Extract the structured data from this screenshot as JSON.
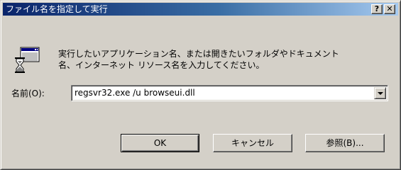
{
  "window": {
    "title": "ファイル名を指定して実行",
    "help_glyph": "?",
    "close_glyph": "✕"
  },
  "dialog": {
    "icon": "run-program-icon",
    "description_line1": "実行したいアプリケーション名、または開きたいフォルダやドキュメント",
    "description_line2": "名、インターネット リソース名を入力してください。"
  },
  "field": {
    "label": "名前(O):",
    "value": "regsvr32.exe /u browseui.dll"
  },
  "buttons": {
    "ok": "OK",
    "cancel": "キャンセル",
    "browse": "参照(B)..."
  },
  "colors": {
    "face": "#d4d0c8",
    "title_start": "#0a246a",
    "title_end": "#a6caf0"
  }
}
